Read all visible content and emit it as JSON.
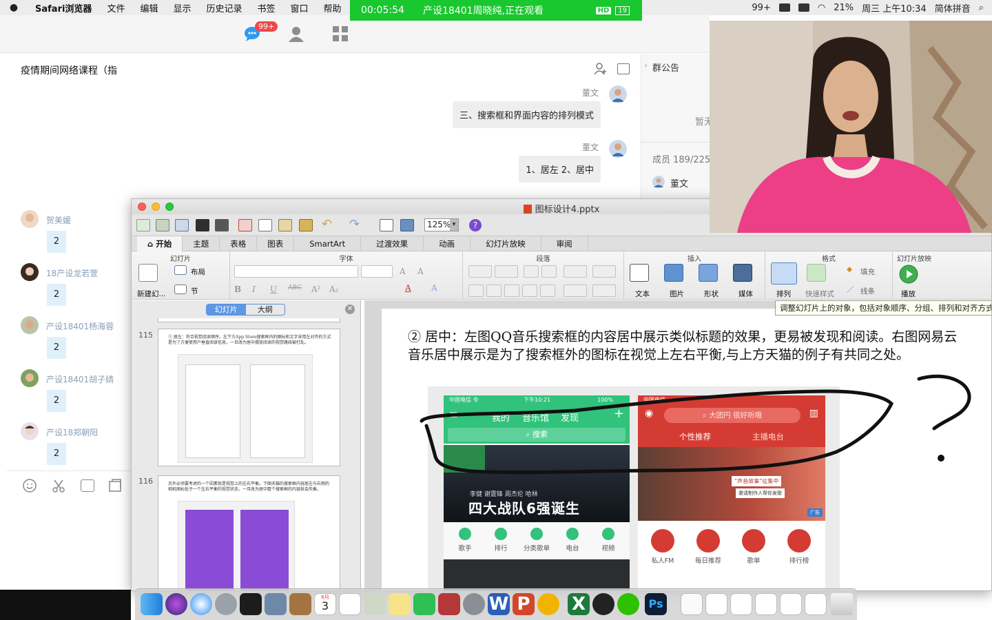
{
  "menubar": {
    "app": "Safari浏览器",
    "items": [
      "文件",
      "编辑",
      "显示",
      "历史记录",
      "书签",
      "窗口",
      "帮助"
    ],
    "right": {
      "wechat_badge": "99+",
      "battery": "21%",
      "clock": "周三 上午10:34",
      "input": "简体拼音"
    }
  },
  "live": {
    "time": "00:05:54",
    "title": "产设18401周晓纯,正在观看",
    "hd": "HD",
    "count": "19"
  },
  "chat": {
    "badge": "99+",
    "title": "疫情期间网络课程（指",
    "messages": [
      {
        "sender": "董文",
        "text": "三、搜索框和界面内容的排列模式"
      },
      {
        "sender": "董文",
        "text": "1、居左  2、居中"
      }
    ],
    "right_panel": {
      "announcement": "群公告",
      "paused": "暂无",
      "members": "成员 189/225",
      "member_name": "董文"
    },
    "members": [
      {
        "name": "贺美媛",
        "count": "2"
      },
      {
        "name": "18产设龙若萱",
        "count": "2"
      },
      {
        "name": "产设18401杨海蓉",
        "count": "2"
      },
      {
        "name": "产设18401胡子婧",
        "count": "2"
      },
      {
        "name": "产设18郑朝阳",
        "count": "2"
      }
    ]
  },
  "ppt": {
    "filename": "图标设计4.pptx",
    "zoom": "125%",
    "help": "?",
    "tabs": [
      "开始",
      "主题",
      "表格",
      "图表",
      "SmartArt",
      "过渡效果",
      "动画",
      "幻灯片放映",
      "审阅"
    ],
    "groups": {
      "slides": "幻灯片",
      "font": "字体",
      "paragraph": "段落",
      "insert": "插入",
      "format": "格式",
      "slideshow": "幻灯片放映"
    },
    "buttons": {
      "new_slide": "新建幻...",
      "layout": "布局",
      "section": "节",
      "text": "文本",
      "picture": "图片",
      "shape": "形状",
      "media": "媒体",
      "arrange": "排列",
      "quick_styles": "快速样式",
      "fill": "填充",
      "line": "线条",
      "play": "播放"
    },
    "tooltip": "调整幻灯片上的对象，包括对象顺序、分组、排列和对齐方式",
    "thumb_tabs": [
      "幻灯片",
      "大纲"
    ],
    "thumbnails": [
      {
        "number": "115",
        "text": "① 居左：符合视觉阅读顺序。左下方App Store搜索框内的图标和文字采用左对齐的方式是为了方便使用户垂直阅读信息，一旦改为居中摆放阅读的视觉路线被打乱。"
      },
      {
        "number": "116",
        "text": "另外必须要考虑的一个因素就是视觉上的左右平衡。下图天猫的搜索框内容居左与右侧的相机图标处于一个左右平衡的视觉状态，一旦改为居中整个搜索框的内容就会失衡。"
      }
    ],
    "slide": {
      "text": "② 居中：左图QQ音乐搜索框的内容居中展示类似标题的效果，更易被发现和阅读。右图网易云音乐居中展示是为了搜索框外的图标在视觉上左右平衡,与上方天猫的例子有共同之处。",
      "qq": {
        "carrier": "中国电信 令",
        "time": "下午10:21",
        "battery": "100%",
        "tabs": [
          "我的",
          "音乐馆",
          "发现"
        ],
        "search": "搜索",
        "banner": "李健 谢霆锋 周杰伦 哈林",
        "banner_title": "四大战队6强诞生",
        "nav": [
          "歌手",
          "排行",
          "分类歌单",
          "电台",
          "视频"
        ]
      },
      "netease": {
        "carrier": "中国电信",
        "search": "大团円 很好听哦",
        "tabs": [
          "个性推荐",
          "主播电台"
        ],
        "banner": "“声音故事”征集中",
        "banner_sub": "邀请制作人帮你发歌",
        "ad": "广告",
        "nav": [
          "私人FM",
          "每日推荐",
          "歌单",
          "排行榜"
        ]
      }
    }
  },
  "dock": {
    "calendar_day": "3",
    "calendar_month": "6月"
  },
  "colors": {
    "qq_green": "#31c27c",
    "netease_red": "#d43c33",
    "banner_green": "#19c72e"
  }
}
